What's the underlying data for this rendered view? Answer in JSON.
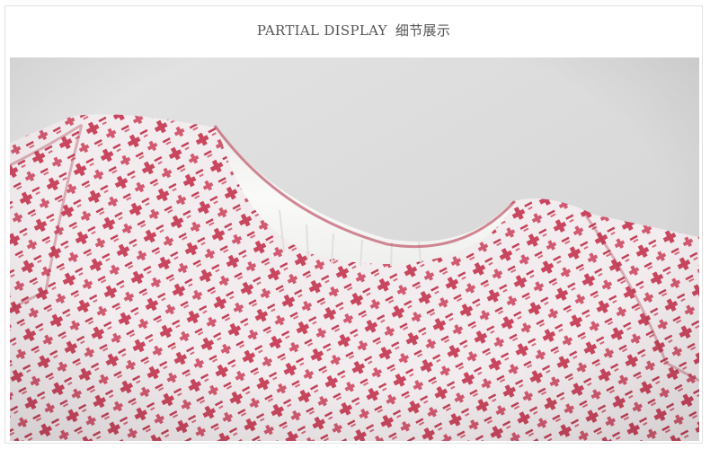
{
  "header": {
    "title_en": "PARTIAL DISPLAY",
    "title_zh": "细节展示"
  },
  "photo": {
    "subject": "fabric-closeup",
    "colors": {
      "fabric_red": "#c9475e",
      "fabric_white": "#f4eef0",
      "lining": "#f7f7f5",
      "background": "#d9d9d9"
    }
  }
}
